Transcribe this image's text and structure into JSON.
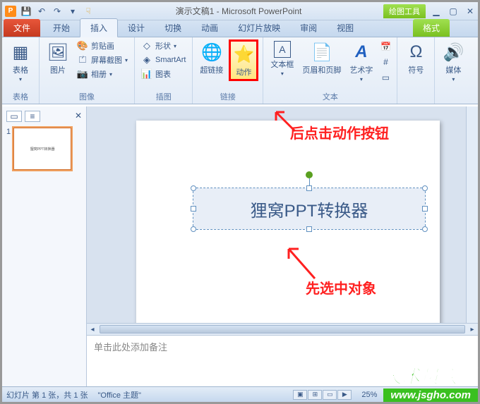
{
  "titlebar": {
    "doc_title": "演示文稿1 - Microsoft PowerPoint",
    "drawing_tools": "绘图工具"
  },
  "tabs": {
    "file": "文件",
    "home": "开始",
    "insert": "插入",
    "design": "设计",
    "transitions": "切换",
    "animations": "动画",
    "slideshow": "幻灯片放映",
    "review": "审阅",
    "view": "视图",
    "format": "格式"
  },
  "ribbon": {
    "tables": {
      "table": "表格",
      "group": "表格"
    },
    "images": {
      "picture": "图片",
      "clipart": "剪贴画",
      "screenshot": "屏幕截图",
      "album": "相册",
      "group": "图像"
    },
    "illustrations": {
      "shapes": "形状",
      "smartart": "SmartArt",
      "chart": "图表",
      "group": "插图"
    },
    "links": {
      "hyperlink": "超链接",
      "action": "动作",
      "group": "链接"
    },
    "text": {
      "textbox": "文本框",
      "header_footer": "页眉和页脚",
      "wordart": "艺术字",
      "group": "文本"
    },
    "symbols": {
      "symbol": "符号"
    },
    "media": {
      "media": "媒体"
    }
  },
  "slidepanel": {
    "slide_number": "1",
    "thumb_text": "狸窝PPT转换器"
  },
  "slide": {
    "text_content": "狸窝PPT转换器"
  },
  "annotations": {
    "click_action": "后点击动作按钮",
    "select_object": "先选中对象"
  },
  "notes": {
    "placeholder": "单击此处添加备注"
  },
  "status": {
    "slide_info": "幻灯片 第 1 张，共 1 张",
    "theme": "\"Office 主题\"",
    "zoom": "25%"
  },
  "watermark": {
    "line1": "技术员联盟",
    "line2": "www.jsgho.com"
  },
  "colors": {
    "accent_red": "#ff0000",
    "anno_red": "#ff2020",
    "green_tab": "#7ac020"
  }
}
